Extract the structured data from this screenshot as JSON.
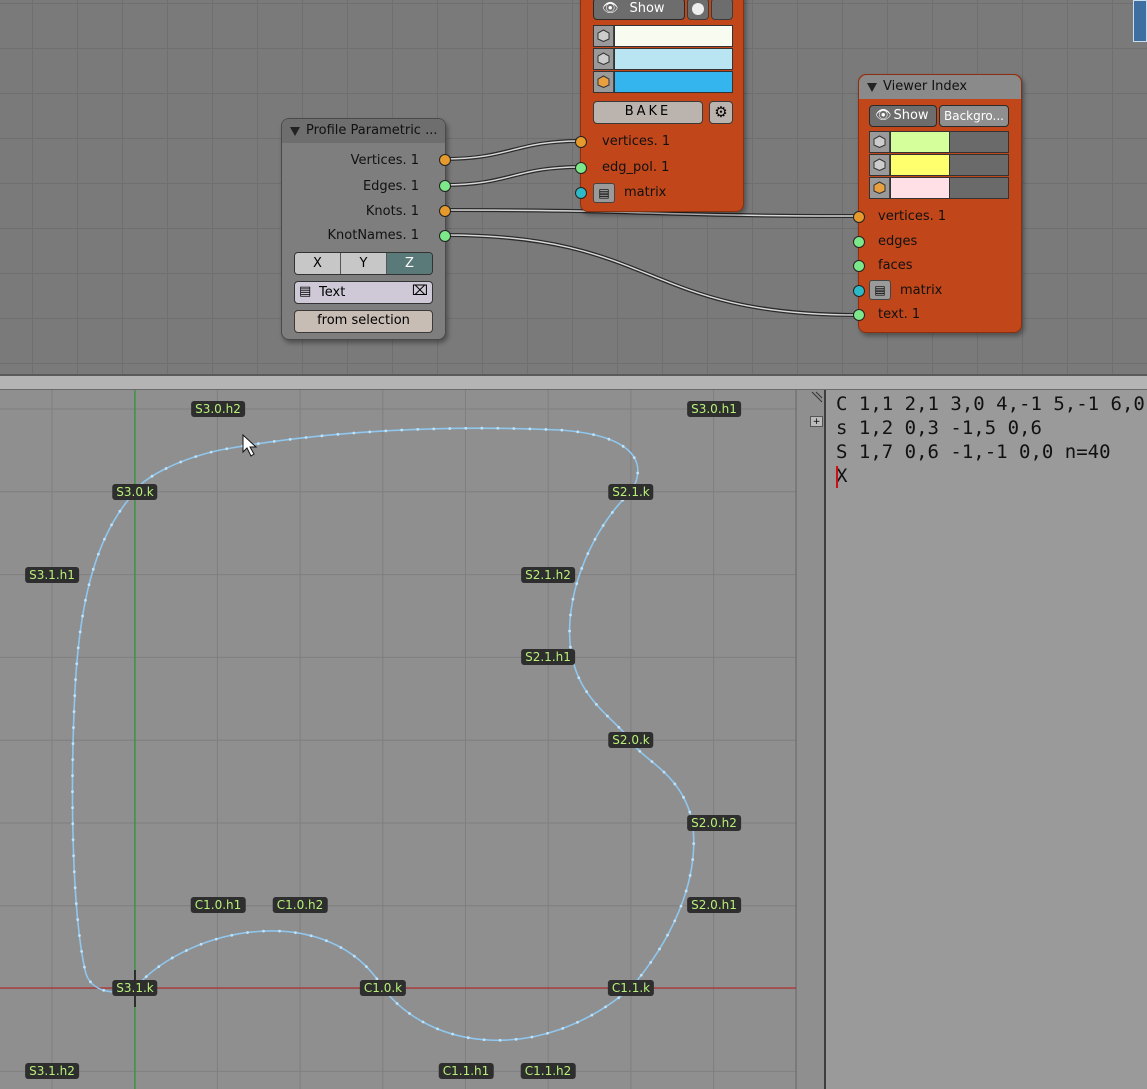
{
  "node_editor": {
    "partial_node": {
      "show_label": "Show",
      "bake_label": "BAKE",
      "sockets": [
        "vertices. 1",
        "edg_pol. 1",
        "matrix"
      ],
      "swatch_colors": [
        "#f8fbef",
        "#b9e4f2",
        "#35b5ee"
      ]
    },
    "profile_node": {
      "title": "Profile Parametric ...",
      "outputs": [
        "Vertices. 1",
        "Edges. 1",
        "Knots. 1",
        "KnotNames. 1"
      ],
      "axis_buttons": [
        "X",
        "Y",
        "Z"
      ],
      "selected_axis": "Z",
      "text_field": "Text",
      "from_selection_label": "from selection"
    },
    "viewer_node": {
      "title": "Viewer Index",
      "show_label": "Show",
      "background_label": "Backgro...",
      "inputs": [
        "vertices. 1",
        "edges",
        "faces",
        "matrix",
        "text. 1"
      ],
      "swatch_colors": [
        "#d4ff9a",
        "#ffff6e",
        "#ffe0e6"
      ]
    }
  },
  "viewport": {
    "knot_labels": [
      "S3.0.h2",
      "S3.0.h1",
      "S3.0.k",
      "S2.1.k",
      "S3.1.h1",
      "S2.1.h2",
      "S2.1.h1",
      "S2.0.k",
      "S2.0.h2",
      "S2.0.h1",
      "C1.0.h1",
      "C1.0.h2",
      "S3.1.k",
      "C1.0.k",
      "C1.1.k",
      "S3.1.h2",
      "C1.1.h1",
      "C1.1.h2"
    ]
  },
  "text_editor": {
    "lines": [
      "C 1,1 2,1 3,0 4,-1 5,-1 6,0",
      "s 1,2 0,3 -1,5 0,6",
      "S 1,7 0,6 -1,-1 0,0 n=40",
      "X"
    ]
  },
  "colors": {
    "node_orange": "#c1461a",
    "curve": "#8fc7ef",
    "x_axis": "#b03030",
    "y_axis": "#2a9a2a",
    "label_text": "#b8f07a"
  }
}
